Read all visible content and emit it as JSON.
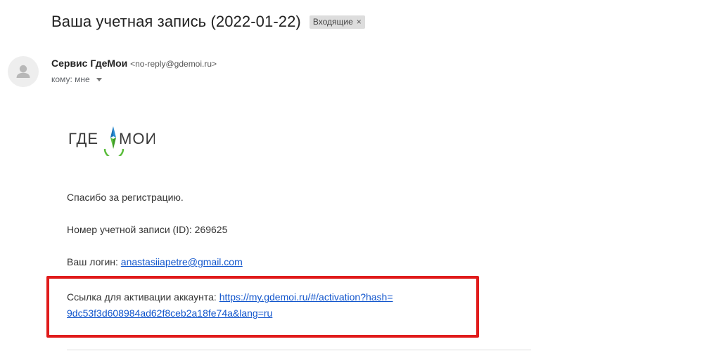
{
  "email": {
    "subject": "Ваша учетная запись (2022-01-22)",
    "label": "Входящие",
    "label_remove": "×",
    "sender_name": "Сервис ГдеМои",
    "sender_email": "<no-reply@gdemoi.ru>",
    "to_text": "кому: мне"
  },
  "logo": {
    "text_left": "ГДЕ",
    "text_right": "МОИ",
    "colors": {
      "text": "#3a3a3a",
      "green": "#5bbd3c",
      "blue": "#2a8fd6"
    }
  },
  "body": {
    "thanks": "Спасибо за регистрацию.",
    "account_id_text": "Номер учетной записи (ID): 269625",
    "login_label": "Ваш логин: ",
    "login_value": "anastasiiapetre@gmail.com",
    "activation_label": "Ссылка для активации аккаунта: ",
    "activation_link_line1": "https://my.gdemoi.ru/#/activation?hash=",
    "activation_link_line2": "9dc53f3d608984ad62f8ceb2a18fe74a&lang=ru"
  },
  "colors": {
    "link": "#1155cc",
    "highlight": "#e01b1b",
    "chip_bg": "#dddddd"
  },
  "icons": {
    "avatar": "person-icon",
    "label_close": "close-icon",
    "to_caret": "chevron-down-icon"
  }
}
